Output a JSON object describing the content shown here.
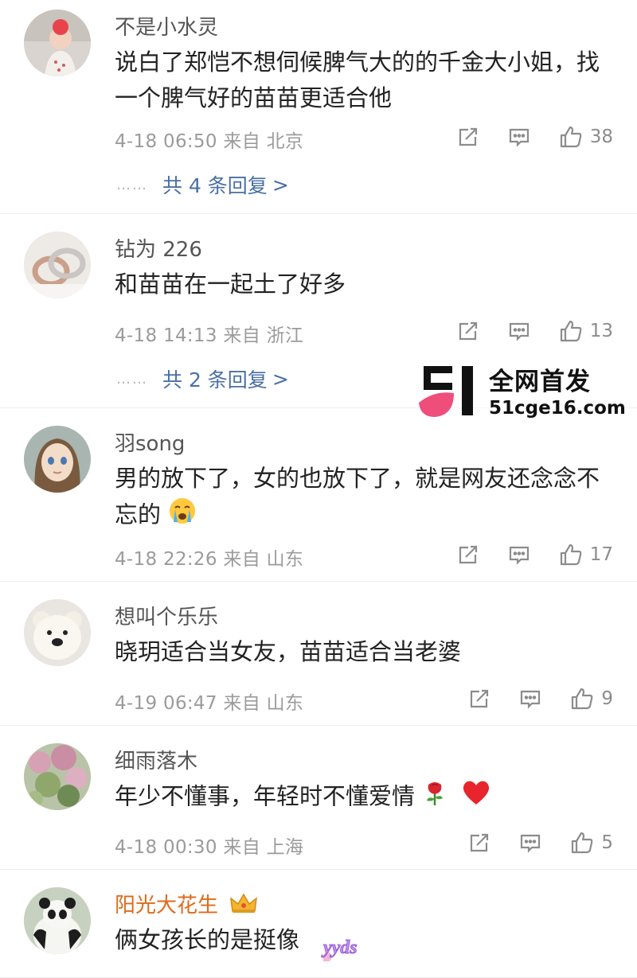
{
  "comments": [
    {
      "user": "不是小水灵",
      "text": "说白了郑恺不想伺候脾气大的的千金大小姐，找一个脾气好的苗苗更适合他",
      "meta": "4-18 06:50  来自 北京",
      "likes": "38",
      "replies": "共 4 条回复"
    },
    {
      "user": "钻为 226",
      "text": "和苗苗在一起土了好多",
      "meta": "4-18 14:13  来自 浙江",
      "likes": "13",
      "replies": "共 2 条回复"
    },
    {
      "user": "羽song",
      "text": "男的放下了，女的也放下了，就是网友还念念不忘的",
      "meta": "4-18 22:26  来自 山东",
      "likes": "17"
    },
    {
      "user": "想叫个乐乐",
      "text": "晓玥适合当女友，苗苗适合当老婆",
      "meta": "4-19 06:47  来自 山东",
      "likes": "9"
    },
    {
      "user": "细雨落木",
      "text": "年少不懂事，年轻时不懂爱情",
      "meta": "4-18 00:30  来自 上海",
      "likes": "5"
    },
    {
      "user": "阳光大花生",
      "text": "俩女孩长的是挺像"
    }
  ],
  "replies_dots": "……",
  "replies_arrow": ">",
  "watermark": {
    "title": "全网首发",
    "url": "51cge16.com"
  },
  "sticker_text": "yyds",
  "colors": {
    "username": "#555555",
    "vip_username": "#e06a1a",
    "reply_link": "#4a6fa5",
    "meta": "#9b9b9b",
    "divider": "#ececec"
  },
  "icons": [
    "repost-icon",
    "comment-icon",
    "like-icon",
    "crying-emoji",
    "rose-emoji",
    "red-heart-emoji",
    "crown-icon"
  ]
}
